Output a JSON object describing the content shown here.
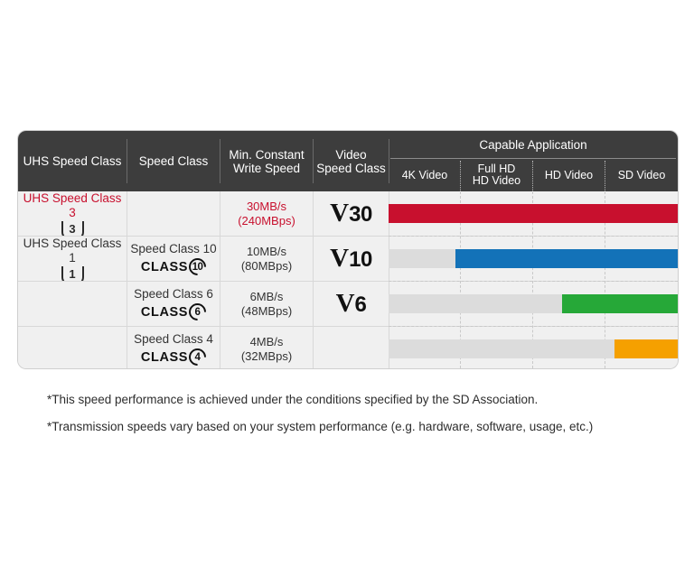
{
  "table": {
    "columns": [
      {
        "label": "UHS Speed Class"
      },
      {
        "label": "Speed Class"
      },
      {
        "label": "Min. Constant\nWrite Speed",
        "line1": "Min. Constant",
        "line2": "Write Speed"
      },
      {
        "label": "Video\nSpeed Class",
        "line1": "Video",
        "line2": "Speed Class"
      }
    ],
    "group_header": "Capable Application",
    "app_columns": [
      {
        "line1": "4K Video",
        "line2": ""
      },
      {
        "line1": "Full HD",
        "line2": "HD Video"
      },
      {
        "line1": "HD Video",
        "line2": ""
      },
      {
        "line1": "SD Video",
        "line2": ""
      }
    ],
    "rows": [
      {
        "uhs_label": "UHS Speed Class 3",
        "uhs_badge": "3",
        "speed_class_label": "",
        "speed_class_badge": "",
        "write_speed_line1": "30MB/s",
        "write_speed_line2": "(240MBps)",
        "video_class_v": "V",
        "video_class_num": "30",
        "highlight": "red",
        "bar_color": "#c8102e",
        "bar_fill_start_pct": 0,
        "bar_fill_end_pct": 100,
        "track_start_pct": 0
      },
      {
        "uhs_label": "UHS Speed Class 1",
        "uhs_badge": "1",
        "speed_class_label": "Speed Class 10",
        "speed_class_badge": "10",
        "write_speed_line1": "10MB/s",
        "write_speed_line2": "(80MBps)",
        "video_class_v": "V",
        "video_class_num": "10",
        "highlight": "none",
        "bar_color": "#1372b8",
        "bar_fill_start_pct": 23,
        "bar_fill_end_pct": 100,
        "track_start_pct": 0
      },
      {
        "uhs_label": "",
        "uhs_badge": "",
        "speed_class_label": "Speed Class 6",
        "speed_class_badge": "6",
        "write_speed_line1": "6MB/s",
        "write_speed_line2": "(48MBps)",
        "video_class_v": "V",
        "video_class_num": "6",
        "highlight": "none",
        "bar_color": "#26a838",
        "bar_fill_start_pct": 60,
        "bar_fill_end_pct": 100,
        "track_start_pct": 0
      },
      {
        "uhs_label": "",
        "uhs_badge": "",
        "speed_class_label": "Speed Class 4",
        "speed_class_badge": "4",
        "write_speed_line1": "4MB/s",
        "write_speed_line2": "(32MBps)",
        "video_class_v": "",
        "video_class_num": "",
        "highlight": "none",
        "bar_color": "#f5a000",
        "bar_fill_start_pct": 78,
        "bar_fill_end_pct": 100,
        "track_start_pct": 0
      }
    ],
    "class_logo_word": "CLASS"
  },
  "footnotes": [
    "*This speed performance is achieved under the conditions specified by the SD Association.",
    "*Transmission speeds vary based on your system performance (e.g. hardware, software, usage, etc.)"
  ],
  "colors": {
    "header_bg": "#3d3d3d",
    "row_bg": "#f0f0f0",
    "track": "#dcdcdc",
    "red": "#c8102e",
    "blue": "#1372b8",
    "green": "#26a838",
    "orange": "#f5a000",
    "accent_text_red": "#c8102e"
  }
}
